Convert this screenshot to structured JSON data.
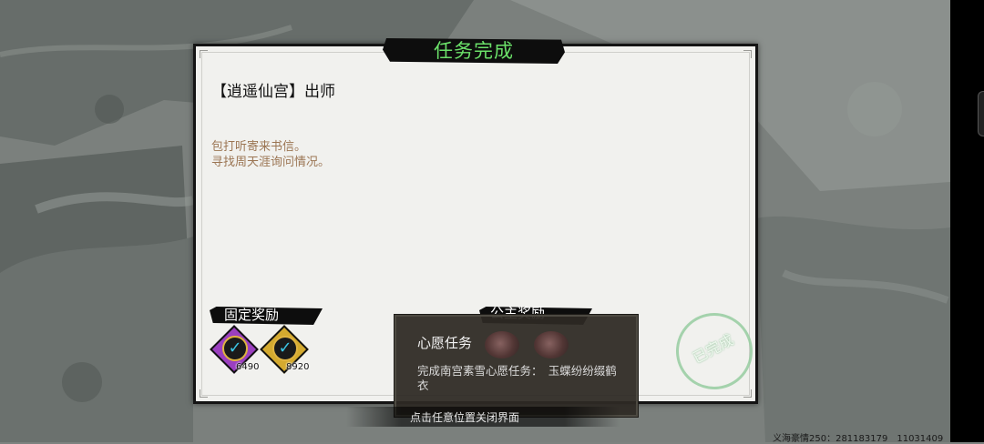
{
  "dialog": {
    "title": "任务完成",
    "quest_name": "【逍遥仙宫】出师",
    "description_lines": [
      "包打听寄来书信。",
      "寻找周天涯询问情况。"
    ],
    "fixed_reward_label": "固定奖励",
    "optional_reward_label": "公主奖励",
    "rewards": [
      {
        "icon": "exp-icon",
        "count": "6490",
        "color": "#9b3fc0"
      },
      {
        "icon": "coin-icon",
        "count": "8920",
        "color": "#d4aa2f"
      }
    ],
    "stamp_text": "已完成",
    "close_hint": "点击任意位置关闭界面"
  },
  "tooltip": {
    "title": "心愿任务",
    "description": "完成南宫素雪心愿任务：　玉蝶纷纷缀鹤衣"
  },
  "footer": {
    "player_info": "义海豪情250：281183179　11031409"
  },
  "colors": {
    "title_green": "#6be069",
    "desc_brown": "#9b7553",
    "panel_bg": "#f1f1ee"
  }
}
